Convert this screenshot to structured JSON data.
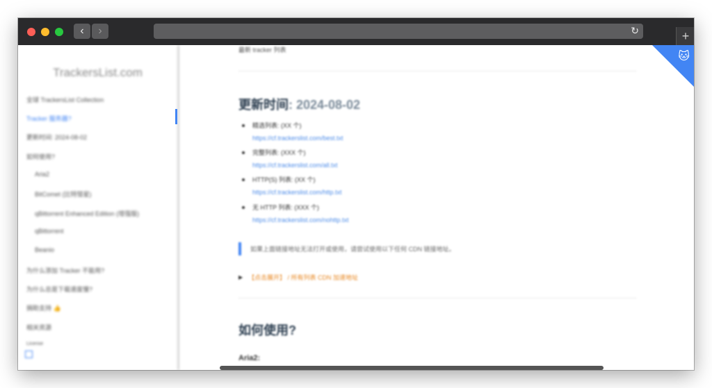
{
  "window": {
    "traffic_lights": {
      "close": "#fe5f57",
      "minimize": "#febc2e",
      "zoom": "#28c840"
    },
    "back_icon": "‹",
    "forward_icon": "›",
    "reload_icon": "↻",
    "new_tab_icon": "+"
  },
  "sidebar": {
    "title": "TrackersList.com",
    "items": [
      {
        "label": "全球 TrackersList Collection"
      },
      {
        "label": "Tracker 服务器?"
      },
      {
        "label": "更新时间: 2024-08-02"
      },
      {
        "label": "如何使用?"
      },
      {
        "label": "Aria2"
      },
      {
        "label": "BitComet (比特彗星)"
      },
      {
        "label": "qBittorrent Enhanced Edition (增强版)"
      },
      {
        "label": "qBittorrent"
      },
      {
        "label": "Beanio"
      },
      {
        "label": "为什么添加 Tracker 不能用?"
      },
      {
        "label": "为什么总是下载速度慢?"
      },
      {
        "label": "捐助支持 👍"
      },
      {
        "label": "相关资源"
      },
      {
        "label": "License"
      }
    ]
  },
  "content": {
    "top_text": "最新 tracker 列表",
    "update_label": "更新时间",
    "update_date": ": 2024-08-02",
    "lists": [
      {
        "title": "精选列表: (XX 个)",
        "url": "https://cf.trackerslist.com/best.txt"
      },
      {
        "title": "完整列表: (XXX 个)",
        "url": "https://cf.trackerslist.com/all.txt"
      },
      {
        "title": "HTTP(S) 列表: (XX 个)",
        "url": "https://cf.trackerslist.com/http.txt"
      },
      {
        "title": "无 HTTP 列表: (XXX 个)",
        "url": "https://cf.trackerslist.com/nohttp.txt"
      }
    ],
    "tip": "如果上面链接地址无法打开或使用，请尝试使用以下任何 CDN 链接地址。",
    "toggle_icon": "▶",
    "orange_note": "【点击展开】 / 所有列表 CDN 加速地址",
    "section_title": "如何使用?",
    "subsection": "Aria2:",
    "corner_icon": "github-cat"
  }
}
